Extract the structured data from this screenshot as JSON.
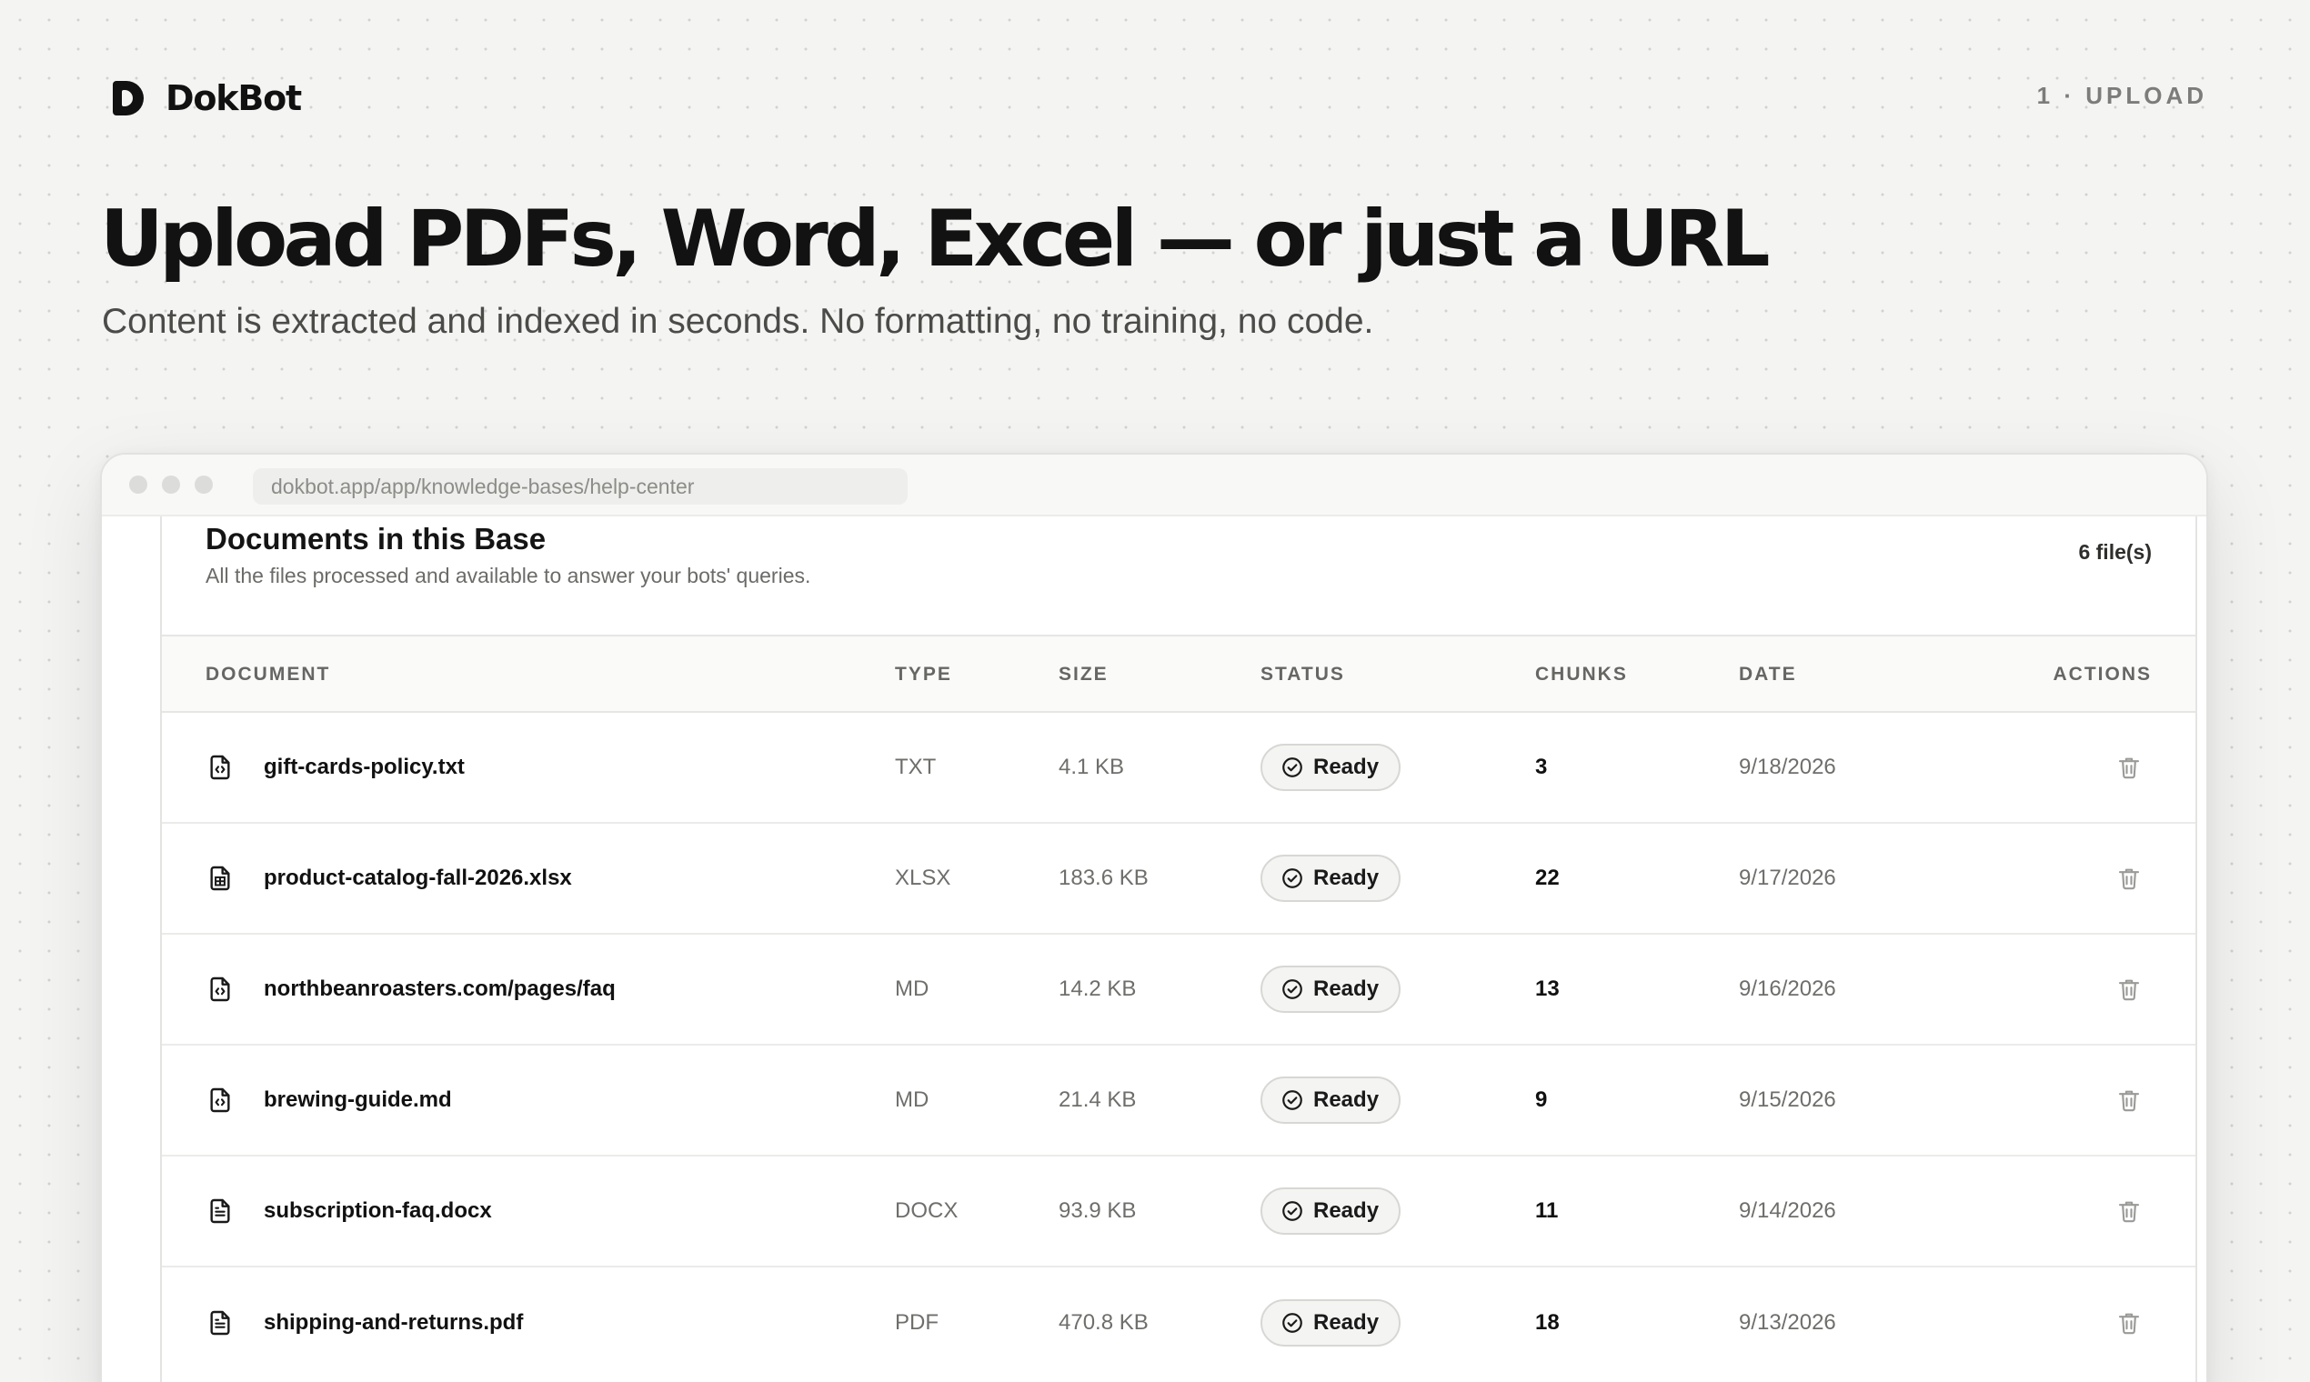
{
  "brand": {
    "name": "DokBot",
    "logo_letter": "D"
  },
  "step_label": "1 · UPLOAD",
  "hero": {
    "title": "Upload PDFs, Word, Excel — or just a URL",
    "subtitle": "Content is extracted and indexed in seconds. No formatting, no training, no code."
  },
  "browser": {
    "url": "dokbot.app/app/knowledge-bases/help-center"
  },
  "documents_card": {
    "title": "Documents in this Base",
    "description": "All the files processed and available to answer your bots' queries.",
    "file_count": "6 file(s)",
    "columns": {
      "document": "DOCUMENT",
      "type": "TYPE",
      "size": "SIZE",
      "status": "STATUS",
      "chunks": "CHUNKS",
      "date": "DATE",
      "actions": "ACTIONS"
    },
    "rows": [
      {
        "name": "gift-cards-policy.txt",
        "icon": "code-file-icon",
        "type": "TXT",
        "size": "4.1 KB",
        "status": "Ready",
        "chunks": "3",
        "date": "9/18/2026"
      },
      {
        "name": "product-catalog-fall-2026.xlsx",
        "icon": "spreadsheet-file-icon",
        "type": "XLSX",
        "size": "183.6 KB",
        "status": "Ready",
        "chunks": "22",
        "date": "9/17/2026"
      },
      {
        "name": "northbeanroasters.com/pages/faq",
        "icon": "code-file-icon",
        "type": "MD",
        "size": "14.2 KB",
        "status": "Ready",
        "chunks": "13",
        "date": "9/16/2026"
      },
      {
        "name": "brewing-guide.md",
        "icon": "code-file-icon",
        "type": "MD",
        "size": "21.4 KB",
        "status": "Ready",
        "chunks": "9",
        "date": "9/15/2026"
      },
      {
        "name": "subscription-faq.docx",
        "icon": "text-file-icon",
        "type": "DOCX",
        "size": "93.9 KB",
        "status": "Ready",
        "chunks": "11",
        "date": "9/14/2026"
      },
      {
        "name": "shipping-and-returns.pdf",
        "icon": "text-file-icon",
        "type": "PDF",
        "size": "470.8 KB",
        "status": "Ready",
        "chunks": "18",
        "date": "9/13/2026"
      }
    ]
  }
}
